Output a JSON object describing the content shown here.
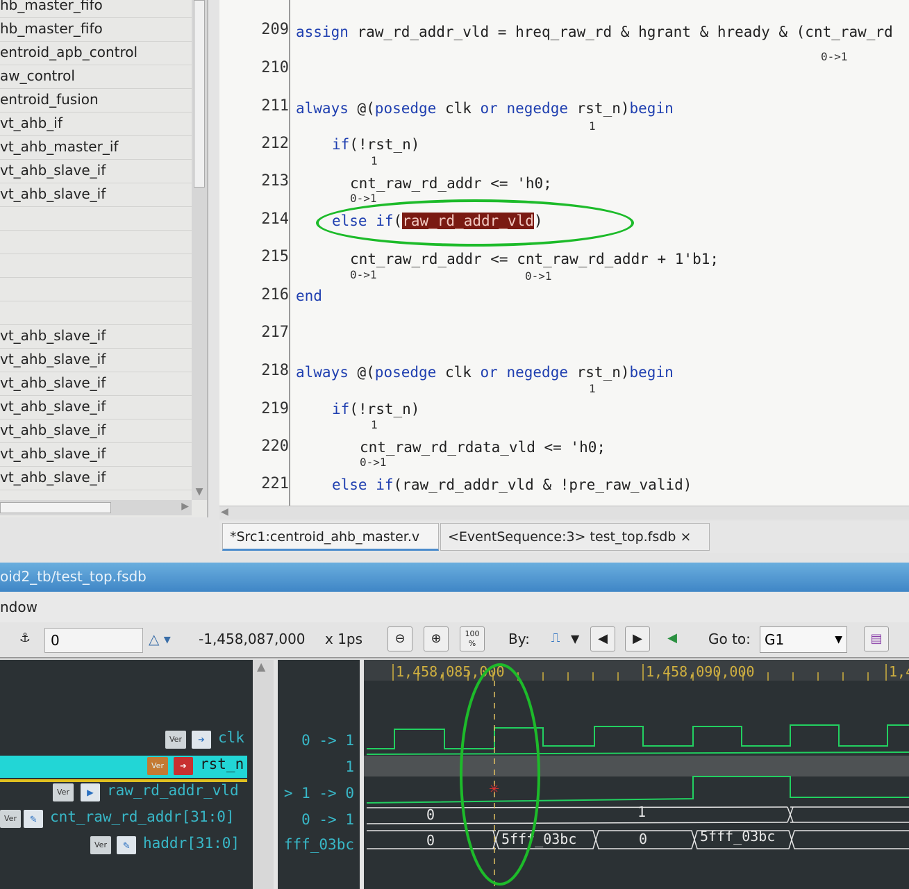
{
  "hierarchy": {
    "items": [
      "hb_master_fifo",
      "hb_master_fifo",
      "entroid_apb_control",
      "aw_control",
      "entroid_fusion",
      "vt_ahb_if",
      "vt_ahb_master_if",
      "vt_ahb_slave_if",
      "vt_ahb_slave_if",
      "vt_ahb_slave_if",
      "vt_ahb_slave_if",
      "vt_ahb_slave_if",
      "vt_ahb_slave_if",
      "vt_ahb_slave_if",
      "vt_ahb_slave_if",
      "vt_ahb_slave_if"
    ]
  },
  "source": {
    "lines": [
      {
        "no": "209",
        "ann": "0->1"
      },
      {
        "no": "210"
      },
      {
        "no": "211",
        "ann": "1"
      },
      {
        "no": "212",
        "ann": "1"
      },
      {
        "no": "213",
        "ann": "0->1"
      },
      {
        "no": "214"
      },
      {
        "no": "215",
        "ann": "0->1",
        "ann2": "0->1"
      },
      {
        "no": "216"
      },
      {
        "no": "217"
      },
      {
        "no": "218",
        "ann": "1"
      },
      {
        "no": "219",
        "ann": "1"
      },
      {
        "no": "220",
        "ann": "0->1"
      },
      {
        "no": "221"
      }
    ],
    "code": {
      "l209_kw": "assign",
      "l209_rest": " raw_rd_addr_vld = hreq_raw_rd & hgrant & hready & (cnt_raw_rd",
      "l211_kw1": "always",
      "l211_mid": " @(",
      "l211_kw2": "posedge",
      "l211_clk": " clk ",
      "l211_kw3": "or",
      "l211_sp": " ",
      "l211_kw4": "negedge",
      "l211_rst": " rst_n)",
      "l211_kw5": "begin",
      "l212_kw": "if",
      "l212_rest": "(!rst_n)",
      "l213": "cnt_raw_rd_addr <= 'h0;",
      "l214_kw1": "else",
      "l214_sp": " ",
      "l214_kw2": "if",
      "l214_open": "(",
      "l214_hl": "raw_rd_addr_vld",
      "l214_close": ")",
      "l215": "cnt_raw_rd_addr <= cnt_raw_rd_addr + 1'b1;",
      "l216_kw": "end",
      "l218_kw1": "always",
      "l218_mid": " @(",
      "l218_kw2": "posedge",
      "l218_clk": " clk ",
      "l218_kw3": "or",
      "l218_sp": " ",
      "l218_kw4": "negedge",
      "l218_rst": " rst_n)",
      "l218_kw5": "begin",
      "l219_kw": "if",
      "l219_rest": "(!rst_n)",
      "l220": "cnt_raw_rd_rdata_vld <= 'h0;",
      "l221_kw1": "else",
      "l221_sp": " ",
      "l221_kw2": "if",
      "l221_rest": "(raw_rd_addr_vld & !pre_raw_valid)"
    }
  },
  "tabs": [
    {
      "label": "*Src1:centroid_ahb_master.v"
    },
    {
      "label": "<EventSequence:3> test_top.fsdb"
    }
  ],
  "tab_close_icon": "×",
  "wave": {
    "title": "oid2_tb/test_top.fsdb",
    "menu": "ndow",
    "toolbar": {
      "time_value": "0",
      "cursor_time": "-1,458,087,000",
      "unit": "x 1ps",
      "zoom_fit": "100\n%",
      "by_label": "By:",
      "goto_label": "Go to:",
      "goto_value": "G1"
    },
    "ruler": [
      "1,458,085,000",
      "1,458,090,000",
      "1,4"
    ],
    "signals": [
      {
        "name": "clk",
        "value": "0 -> 1"
      },
      {
        "name": "rst_n",
        "value": "1"
      },
      {
        "name": "raw_rd_addr_vld",
        "value": "> 1 -> 0"
      },
      {
        "name": "cnt_raw_rd_addr[31:0]",
        "value": "0 -> 1"
      },
      {
        "name": "haddr[31:0]",
        "value": "fff_03bc"
      }
    ],
    "badge": "Ver",
    "bus_labels": {
      "cnt_a": "0",
      "cnt_b": "1",
      "haddr_a": "0",
      "haddr_b": "5fff_03bc",
      "haddr_c": "0",
      "haddr_d": "5fff_03bc"
    },
    "colors": {
      "wave": "#22d060",
      "bg": "#2b3134",
      "cursor": "#e0c060",
      "annotation": "#1dbb2a"
    }
  }
}
